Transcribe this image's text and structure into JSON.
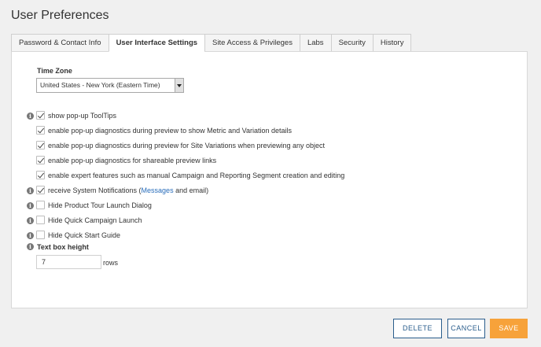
{
  "page": {
    "title": "User Preferences"
  },
  "tabs": [
    {
      "label": "Password & Contact Info",
      "active": false
    },
    {
      "label": "User Interface Settings",
      "active": true
    },
    {
      "label": "Site Access & Privileges",
      "active": false
    },
    {
      "label": "Labs",
      "active": false
    },
    {
      "label": "Security",
      "active": false
    },
    {
      "label": "History",
      "active": false
    }
  ],
  "timezone": {
    "label": "Time Zone",
    "selected": "United States - New York (Eastern Time)"
  },
  "options": {
    "tooltips": {
      "label": "show pop-up ToolTips",
      "checked": true
    },
    "diag_metric": {
      "label": "enable pop-up diagnostics during preview to show Metric and Variation details",
      "checked": true
    },
    "diag_site": {
      "label": "enable pop-up diagnostics during preview for Site Variations when previewing any object",
      "checked": true
    },
    "diag_share": {
      "label": "enable pop-up diagnostics for shareable preview links",
      "checked": true
    },
    "expert": {
      "label": "enable expert features such as manual Campaign and Reporting Segment creation and editing",
      "checked": true
    },
    "notifications": {
      "label_prefix": "receive System Notifications (",
      "link": "Messages",
      "label_suffix": " and email)",
      "checked": true
    },
    "hide_tour": {
      "label": "Hide Product Tour Launch Dialog",
      "checked": false
    },
    "hide_campaign": {
      "label": "Hide Quick Campaign Launch",
      "checked": false
    },
    "hide_start": {
      "label": "Hide Quick Start Guide",
      "checked": false
    }
  },
  "textbox": {
    "label": "Text box height",
    "value": "7",
    "unit": "rows"
  },
  "buttons": {
    "delete": "DELETE",
    "cancel": "CANCEL",
    "save": "SAVE"
  },
  "colors": {
    "accent": "#f7a23a",
    "link": "#2a6ebb",
    "outline": "#2a5d8c"
  },
  "icons": {
    "info": "info-icon",
    "check": "checkmark-icon",
    "dropdown": "chevron-down-icon"
  }
}
